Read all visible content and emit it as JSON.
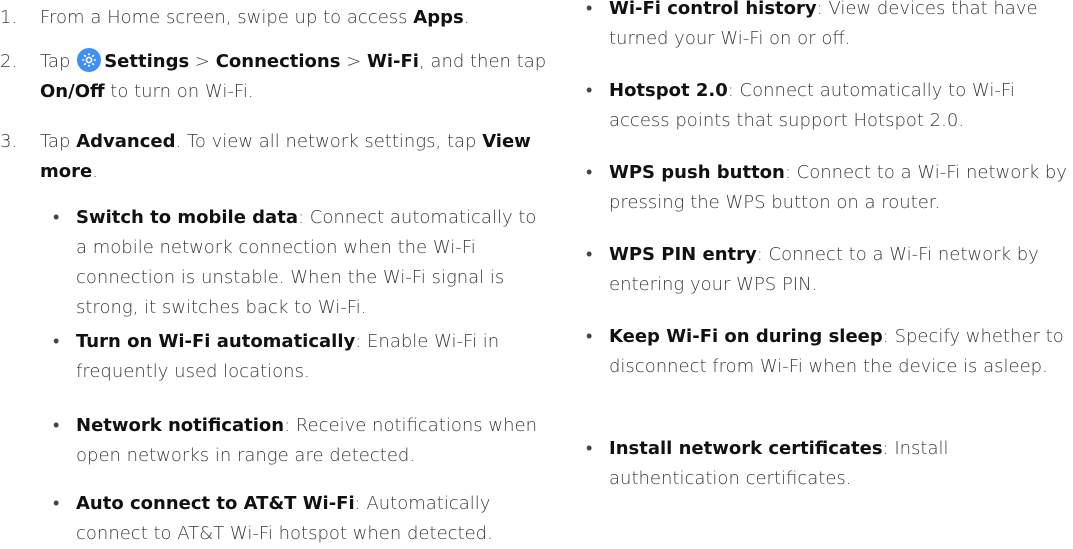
{
  "left": {
    "step1": {
      "num": "1.",
      "t1": "From a Home screen, swipe up to access ",
      "b1": "Apps",
      "t2": "."
    },
    "step2": {
      "num": "2.",
      "t1": "Tap ",
      "icon": "settings-gear-icon",
      "b1": "Settings",
      "sep1": " > ",
      "b2": "Connections",
      "sep2": " > ",
      "b3": "Wi-Fi",
      "t2": ", and then tap ",
      "b4": "On/Off",
      "t3": " to turn on Wi-Fi."
    },
    "step3": {
      "num": "3.",
      "t1": "Tap ",
      "b1": "Advanced",
      "t2": ". To view all network settings, tap ",
      "b2": "View more",
      "t3": "."
    },
    "bullets": [
      {
        "dot": "•",
        "term": "Switch to mobile data",
        "desc": ": Connect automatically to a mobile network connection when the Wi-Fi connection is unstable. When the Wi-Fi signal is strong, it switches back to Wi-Fi."
      },
      {
        "dot": "•",
        "term": "Turn on Wi-Fi automatically",
        "desc": ": Enable Wi-Fi in frequently used locations."
      },
      {
        "dot": "•",
        "term": "Network notification",
        "desc": ": Receive notifications when open networks in range are detected."
      },
      {
        "dot": "•",
        "term": "Auto connect to AT&T Wi-Fi",
        "desc": ": Automatically connect to AT&T Wi-Fi hotspot when detected."
      }
    ]
  },
  "right": {
    "bullets": [
      {
        "dot": "•",
        "term": "Wi-Fi control history",
        "desc": ": View devices that have turned your Wi-Fi on or off."
      },
      {
        "dot": "•",
        "term": "Hotspot 2.0",
        "desc": ": Connect automatically to Wi-Fi access points that support Hotspot 2.0."
      },
      {
        "dot": "•",
        "term": "WPS push button",
        "desc": ": Connect to a Wi-Fi network by pressing the WPS button on a router."
      },
      {
        "dot": "•",
        "term": "WPS PIN entry",
        "desc": ": Connect to a Wi-Fi network by entering your WPS PIN."
      },
      {
        "dot": "•",
        "term": "Keep Wi-Fi on during sleep",
        "desc": ": Specify whether to disconnect from Wi-Fi when the device is asleep."
      },
      {
        "dot": "•",
        "term": "Install network certificates",
        "desc": ": Install authentication certificates."
      }
    ]
  },
  "colors": {
    "text": "#3a3a3a",
    "bold": "#111111",
    "icon": "#3f8ff5"
  }
}
